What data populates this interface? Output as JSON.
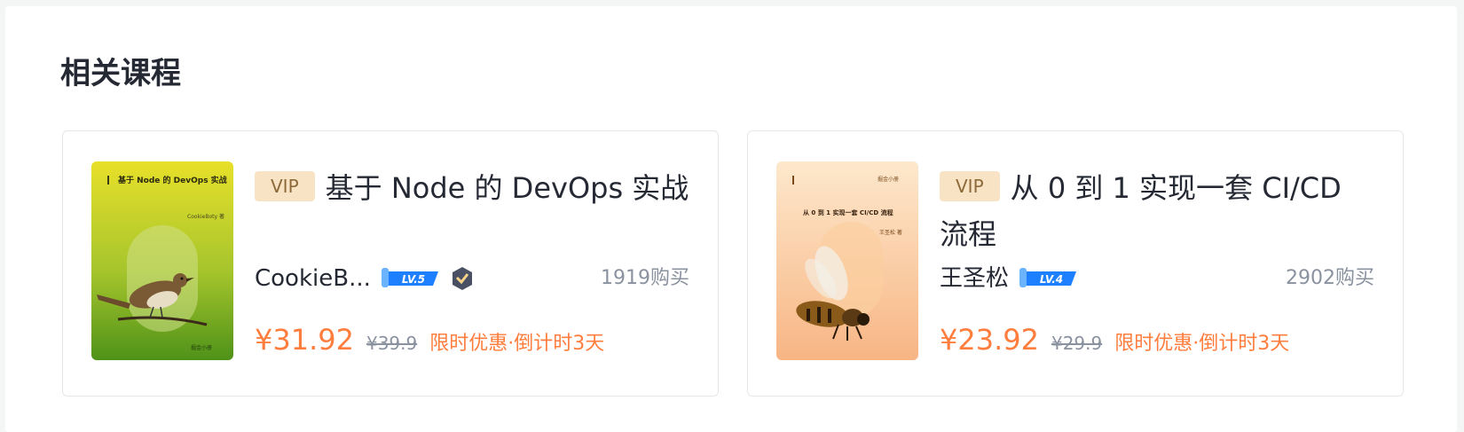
{
  "section": {
    "title": "相关课程"
  },
  "courses": [
    {
      "vip_label": "VIP",
      "title": "基于 Node 的 DevOps 实战",
      "author": "CookieB...",
      "level": "LV.5",
      "buy_count": "1919购买",
      "price": "¥31.92",
      "old_price": "¥39.9",
      "promo": "限时优惠·倒计时3天",
      "cover": {
        "title_text": "基于 Node 的 DevOps 实战",
        "author_text": "CookieBoty 著",
        "publisher_text": "掘金小册",
        "colors": [
          "#e7e12b",
          "#5a9b1e"
        ]
      }
    },
    {
      "vip_label": "VIP",
      "title": "从 0 到 1 实现一套 CI/CD 流程",
      "author": "王圣松",
      "level": "LV.4",
      "buy_count": "2902购买",
      "price": "¥23.92",
      "old_price": "¥29.9",
      "promo": "限时优惠·倒计时3天",
      "cover": {
        "title_text": "从 0 到 1 实现一套 CI/CD 流程",
        "author_text": "王圣松 著",
        "publisher_text": "掘金小册",
        "colors": [
          "#fde7cb",
          "#f9b886"
        ]
      }
    }
  ]
}
